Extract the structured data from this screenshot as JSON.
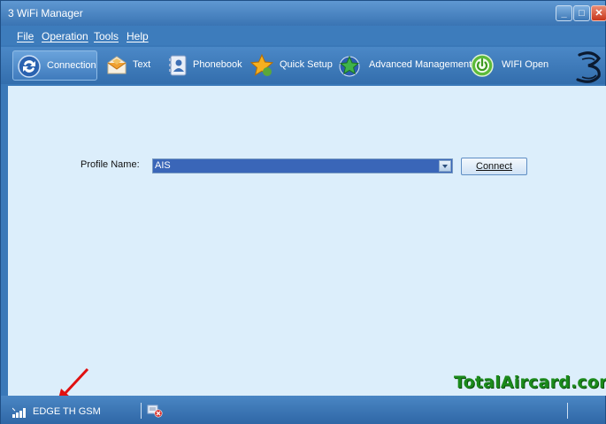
{
  "window": {
    "title": "3 WiFi Manager"
  },
  "menu": {
    "file": "File",
    "operation": "Operation",
    "tools": "Tools",
    "help": "Help"
  },
  "toolbar": {
    "connection": "Connection",
    "text": "Text",
    "phonebook": "Phonebook",
    "quick_setup": "Quick Setup",
    "advanced_management": "Advanced Management",
    "wifi_open": "WIFI Open"
  },
  "main": {
    "profile_label": "Profile Name:",
    "profile_value": "AIS",
    "connect_label": "Connect"
  },
  "watermark": "TotalAircard.com",
  "status": {
    "network": "EDGE  TH GSM"
  },
  "colors": {
    "frame": "#3a78b8",
    "content_bg": "#dceefb",
    "selection": "#3a66b8",
    "watermark": "#1b8a1b"
  }
}
